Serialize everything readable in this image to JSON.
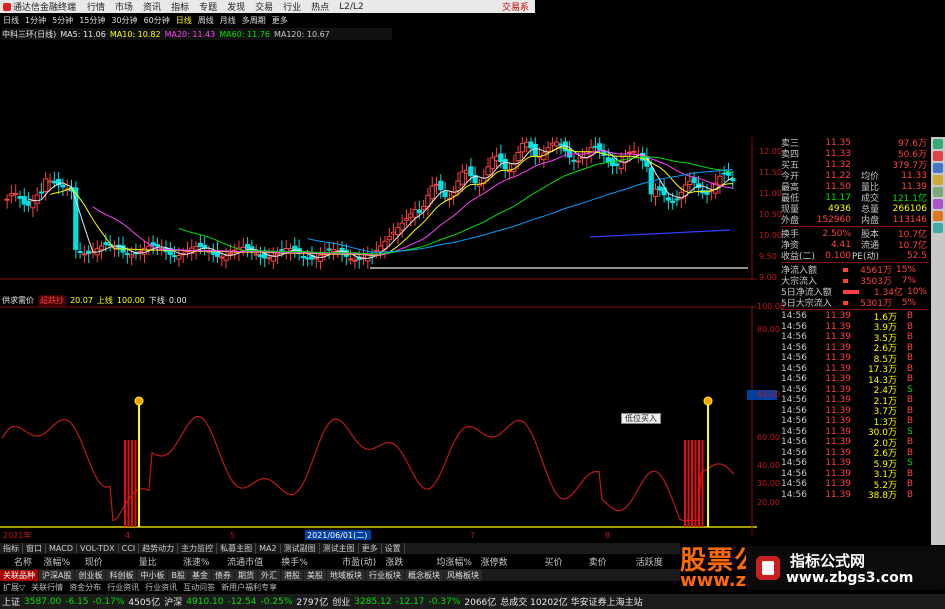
{
  "menu": {
    "brand": "通达信金融终端",
    "items": [
      "行情",
      "市场",
      "资讯",
      "指标",
      "专题",
      "发现",
      "交易",
      "行业",
      "热点",
      "L2/L2"
    ],
    "trade": "交易系"
  },
  "periods": [
    "日线",
    "1分钟",
    "5分钟",
    "15分钟",
    "30分钟",
    "60分钟",
    "日线",
    "周线",
    "月线",
    "多周期",
    "更多"
  ],
  "active_period_index": 6,
  "ma_line": {
    "stock": "中科三环(日线)",
    "items": [
      {
        "label": "MA5: 11.06",
        "color": "#e8e8e8"
      },
      {
        "label": "MA10: 10.82",
        "color": "#ffff00"
      },
      {
        "label": "MA20: 11.43",
        "color": "#ff40ff"
      },
      {
        "label": "MA60: 11.76",
        "color": "#00e000"
      },
      {
        "label": "MA120: 10.67",
        "color": "#c8c8c8"
      }
    ]
  },
  "price_axis": [
    "12.00",
    "11.50",
    "11.00",
    "10.50",
    "10.00",
    "9.50",
    "9.00"
  ],
  "indicator": {
    "name": "供求需价",
    "tag": "超跌抄",
    "value": "20.07",
    "up_label": "上线",
    "up_value": "100.00",
    "down_label": "下线",
    "down_value": "0.00",
    "axis": [
      "100.00",
      "80.00",
      "69.50",
      "60.00",
      "40.00",
      "30.00",
      "20.00"
    ],
    "tooltip": "低位买入"
  },
  "date_axis": {
    "left": "2021年",
    "marker": "2021/06/01(二)",
    "months": [
      "4",
      "5",
      "7",
      "8"
    ]
  },
  "quote_panel": {
    "rows": [
      {
        "label": "卖三",
        "price": "11.35",
        "vol": "",
        "extra": "97.6万",
        "pc": "red"
      },
      {
        "label": "卖四",
        "price": "11.33",
        "vol": "",
        "extra": "50.6万",
        "pc": "red"
      },
      {
        "label": "买五",
        "price": "11.32",
        "vol": "",
        "extra": "379.7万",
        "pc": "red"
      },
      {
        "label": "今开",
        "price": "11.22",
        "vol": "均价",
        "extra": "11.33",
        "pc": "red"
      },
      {
        "label": "最高",
        "price": "11.50",
        "vol": "量比",
        "extra": "11.39",
        "pc": "red"
      },
      {
        "label": "最低",
        "price": "11.17",
        "vol": "成交",
        "extra": "121.1亿",
        "pc": "green"
      },
      {
        "label": "现量",
        "price": "4936",
        "vol": "总量",
        "extra": "266106",
        "pc": "yellow"
      },
      {
        "label": "外盘",
        "price": "152960",
        "vol": "内盘",
        "extra": "113146",
        "pc": "red"
      }
    ],
    "rows2": [
      {
        "label": "换手",
        "price": "2.50%",
        "vol": "股本",
        "extra": "10.7亿"
      },
      {
        "label": "净资",
        "price": "4.41",
        "vol": "流通",
        "extra": "10.7亿"
      },
      {
        "label": "收益(二)",
        "price": "0.100",
        "vol": "PE(动)",
        "extra": "52.5"
      }
    ],
    "flows": [
      {
        "label": "净流入额",
        "value": "4561万",
        "pct": "15%"
      },
      {
        "label": "大宗流入",
        "value": "3503万",
        "pct": "7%"
      },
      {
        "label": "5日净流入额",
        "value": "1.34亿",
        "pct": "10%"
      },
      {
        "label": "5日大宗流入",
        "value": "5301万",
        "pct": "5%"
      }
    ],
    "ticks": [
      {
        "t": "14:56",
        "p": "11.39",
        "v": "1.6万",
        "d": "B"
      },
      {
        "t": "14:56",
        "p": "11.39",
        "v": "3.9万",
        "d": "B"
      },
      {
        "t": "14:56",
        "p": "11.39",
        "v": "3.5万",
        "d": "B"
      },
      {
        "t": "14:56",
        "p": "11.39",
        "v": "2.6万",
        "d": "B"
      },
      {
        "t": "14:56",
        "p": "11.39",
        "v": "8.5万",
        "d": "B"
      },
      {
        "t": "14:56",
        "p": "11.39",
        "v": "17.3万",
        "d": "B"
      },
      {
        "t": "14:56",
        "p": "11.39",
        "v": "14.3万",
        "d": "B"
      },
      {
        "t": "14:56",
        "p": "11.39",
        "v": "2.4万",
        "d": "S"
      },
      {
        "t": "14:56",
        "p": "11.39",
        "v": "2.1万",
        "d": "B"
      },
      {
        "t": "14:56",
        "p": "11.39",
        "v": "3.7万",
        "d": "B"
      },
      {
        "t": "14:56",
        "p": "11.39",
        "v": "1.3万",
        "d": "B"
      },
      {
        "t": "14:56",
        "p": "11.39",
        "v": "30.0万",
        "d": "S"
      },
      {
        "t": "14:56",
        "p": "11.39",
        "v": "2.0万",
        "d": "B"
      },
      {
        "t": "14:56",
        "p": "11.39",
        "v": "2.6万",
        "d": "B"
      },
      {
        "t": "14:56",
        "p": "11.39",
        "v": "5.9万",
        "d": "S"
      },
      {
        "t": "14:56",
        "p": "11.39",
        "v": "3.1万",
        "d": "B"
      },
      {
        "t": "14:56",
        "p": "11.39",
        "v": "5.2万",
        "d": "B"
      },
      {
        "t": "14:56",
        "p": "11.39",
        "v": "38.8万",
        "d": "B"
      }
    ]
  },
  "tabs1": [
    "指标",
    "窗口",
    "MACD",
    "VOL-TDX",
    "CCI",
    "趋势动力",
    "主力监控",
    "私募主图",
    "MA2",
    "测试副图",
    "测试主图",
    "更多",
    "设置"
  ],
  "header_cols": [
    "名称",
    "涨幅%",
    "现价",
    "量比",
    "涨速%",
    "流通市值",
    "换手%",
    "市盈(动)",
    "涨跌",
    "均涨幅%",
    "涨停数",
    "买价",
    "卖价",
    "活跃度"
  ],
  "tabs2": [
    "关联品种",
    "沪深A股",
    "创业板",
    "科创板",
    "中小板",
    "B股",
    "基金",
    "债券",
    "期货",
    "外汇",
    "港股",
    "美股",
    "地域板块",
    "行业板块",
    "概念板块",
    "风格板块"
  ],
  "active_tab2_index": 0,
  "tabs3": [
    "扩展▽",
    "关联行情",
    "资金分布",
    "行业资讯",
    "行业资讯",
    "互动问答",
    "新用户福利专享"
  ],
  "status": [
    {
      "label": "上证",
      "value": "3587.00",
      "chg": "-6.15",
      "pct": "-0.17%",
      "amt": "4505亿"
    },
    {
      "label": "沪深",
      "value": "4910.10",
      "chg": "-12.54",
      "pct": "-0.25%",
      "amt": "2797亿"
    },
    {
      "label": "创业",
      "value": "3285.12",
      "chg": "-12.17",
      "pct": "-0.37%",
      "amt": "2066亿"
    }
  ],
  "status_tail": "总成交 10202亿  华安证券上海主站",
  "watermark": {
    "big": "股票公式网",
    "url": "www.zbgs3.com",
    "title": "指标公式网",
    "site": "www.zbgs3.com"
  },
  "chart_data": {
    "type": "candlestick",
    "title": "中科三环(日线)",
    "ylim": [
      9.0,
      12.2
    ],
    "up_color": "#ff4040",
    "down_color": "#00e0e0"
  }
}
